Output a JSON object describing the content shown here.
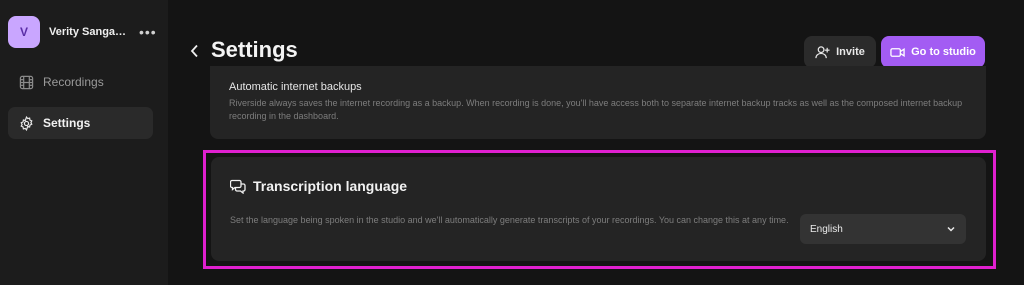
{
  "sidebar": {
    "workspace": {
      "avatar_letter": "V",
      "name": "Verity Sangan's ...",
      "more": "•••"
    },
    "items": [
      {
        "label": "Recordings",
        "icon": "film-icon",
        "active": false
      },
      {
        "label": "Settings",
        "icon": "gear-icon",
        "active": true
      }
    ]
  },
  "header": {
    "title": "Settings",
    "invite_label": "Invite",
    "studio_label": "Go to studio"
  },
  "backups": {
    "title": "Automatic internet backups",
    "description": "Riverside always saves the internet recording as a backup. When recording is done, you'll have access both to separate internet backup tracks as well as the composed internet backup recording in the dashboard."
  },
  "transcription": {
    "title": "Transcription language",
    "description": "Set the language being spoken in the studio and we'll automatically generate transcripts of your recordings. You can change this at any time.",
    "selected_language": "English"
  },
  "colors": {
    "accent": "#a35cf3",
    "highlight": "#e020d0",
    "avatar_bg": "#c9a6ff"
  }
}
